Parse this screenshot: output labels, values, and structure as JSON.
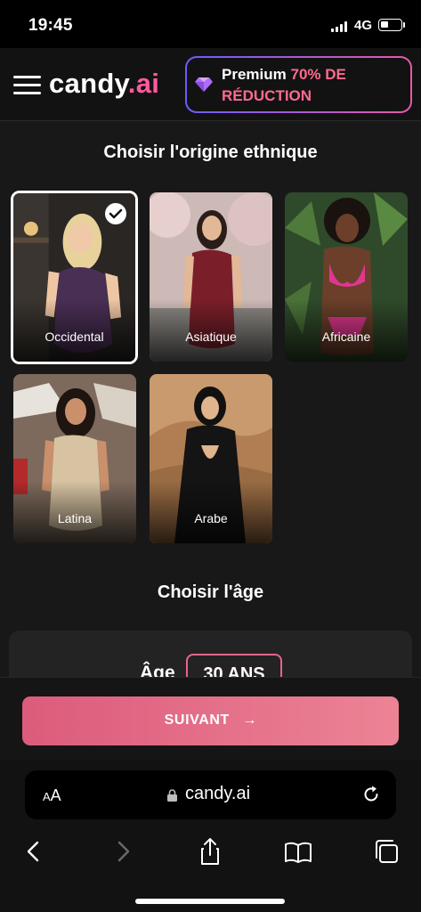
{
  "status_bar": {
    "time": "19:45",
    "network": "4G"
  },
  "header": {
    "logo_main": "candy",
    "logo_accent": ".ai",
    "premium_label": "Premium",
    "premium_discount": "70% DE RÉDUCTION",
    "gem_icon": "gem-icon"
  },
  "ethnicity": {
    "title": "Choisir l'origine ethnique",
    "options": [
      {
        "label": "Occidental",
        "selected": true
      },
      {
        "label": "Asiatique",
        "selected": false
      },
      {
        "label": "Africaine",
        "selected": false
      },
      {
        "label": "Latina",
        "selected": false
      },
      {
        "label": "Arabe",
        "selected": false
      }
    ]
  },
  "age": {
    "title": "Choisir l'âge",
    "label": "Âge",
    "value": "30 ANS"
  },
  "footer": {
    "next_label": "SUIVANT",
    "next_icon": "arrow-right-icon"
  },
  "browser": {
    "text_size_label": "AA",
    "url": "candy.ai",
    "toolbar_icons": [
      "back-icon",
      "forward-icon",
      "share-icon",
      "bookmarks-icon",
      "tabs-icon"
    ]
  },
  "colors": {
    "accent_pink": "#ff5a9e",
    "discount_pink": "#ff6b8f",
    "button_gradient_start": "#dc5b7c",
    "button_gradient_end": "#ec8395",
    "premium_border_start": "#6a5cff",
    "premium_border_end": "#e65aa8"
  }
}
